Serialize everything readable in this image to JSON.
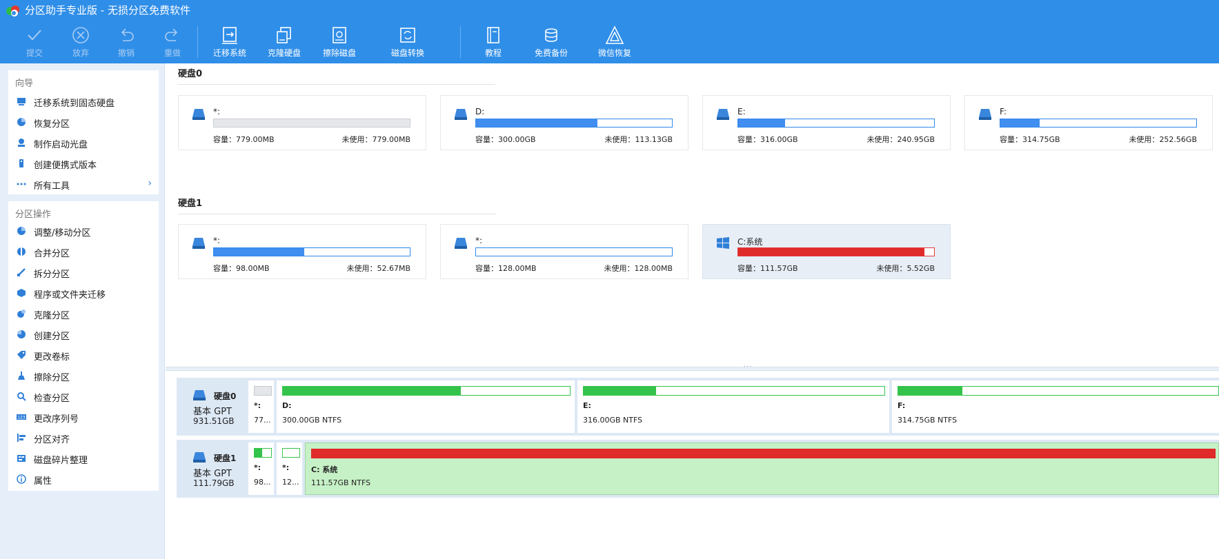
{
  "window": {
    "title": "分区助手专业版 - 无损分区免费软件"
  },
  "toolbar": {
    "items": [
      {
        "label": "提交",
        "icon": "check-icon",
        "enabled": false
      },
      {
        "label": "放弃",
        "icon": "close-circle-icon",
        "enabled": false
      },
      {
        "label": "撤销",
        "icon": "undo-icon",
        "enabled": false
      },
      {
        "label": "重做",
        "icon": "redo-icon",
        "enabled": false
      },
      {
        "label": "迁移系统",
        "icon": "migrate-os-icon",
        "enabled": true
      },
      {
        "label": "克隆硬盘",
        "icon": "clone-disk-icon",
        "enabled": true
      },
      {
        "label": "擦除磁盘",
        "icon": "wipe-disk-icon",
        "enabled": true
      },
      {
        "label": "磁盘转换",
        "icon": "disk-convert-icon",
        "enabled": true
      },
      {
        "label": "教程",
        "icon": "book-icon",
        "enabled": true
      },
      {
        "label": "免费备份",
        "icon": "backup-icon",
        "enabled": true
      },
      {
        "label": "微信恢复",
        "icon": "recovery-icon",
        "enabled": true
      }
    ]
  },
  "sidebar": {
    "wizard": {
      "title": "向导",
      "items": [
        {
          "label": "迁移系统到固态硬盘",
          "icon": "migrate-ssd-icon"
        },
        {
          "label": "恢复分区",
          "icon": "restore-partition-icon"
        },
        {
          "label": "制作启动光盘",
          "icon": "boot-disc-icon"
        },
        {
          "label": "创建便携式版本",
          "icon": "portable-icon"
        },
        {
          "label": "所有工具",
          "icon": "more-dots-icon"
        }
      ]
    },
    "operations": {
      "title": "分区操作",
      "items": [
        {
          "label": "调整/移动分区",
          "icon": "resize-icon"
        },
        {
          "label": "合并分区",
          "icon": "merge-icon"
        },
        {
          "label": "拆分分区",
          "icon": "split-icon"
        },
        {
          "label": "程序或文件夹迁移",
          "icon": "app-move-icon"
        },
        {
          "label": "克隆分区",
          "icon": "clone-partition-icon"
        },
        {
          "label": "创建分区",
          "icon": "create-partition-icon"
        },
        {
          "label": "更改卷标",
          "icon": "label-tag-icon"
        },
        {
          "label": "擦除分区",
          "icon": "wipe-partition-icon"
        },
        {
          "label": "检查分区",
          "icon": "check-partition-icon"
        },
        {
          "label": "更改序列号",
          "icon": "serial-number-icon"
        },
        {
          "label": "分区对齐",
          "icon": "align-icon"
        },
        {
          "label": "磁盘碎片整理",
          "icon": "defrag-icon"
        },
        {
          "label": "属性",
          "icon": "info-icon"
        }
      ]
    }
  },
  "labels": {
    "capacity": "容量：",
    "unused": "未使用："
  },
  "disks": [
    {
      "title": "硬盘0",
      "type": "基本 GPT",
      "size": "931.51GB",
      "partitions": [
        {
          "name": "*:",
          "capacity": "779.00MB",
          "unused": "779.00MB",
          "used_fraction": 0.0,
          "short": "77...",
          "style": "gray"
        },
        {
          "name": "D:",
          "capacity": "300.00GB",
          "unused": "113.13GB",
          "used_fraction": 0.62,
          "info": "300.00GB NTFS",
          "style": "blue"
        },
        {
          "name": "E:",
          "capacity": "316.00GB",
          "unused": "240.95GB",
          "used_fraction": 0.24,
          "info": "316.00GB NTFS",
          "style": "blue"
        },
        {
          "name": "F:",
          "capacity": "314.75GB",
          "unused": "252.56GB",
          "used_fraction": 0.2,
          "info": "314.75GB NTFS",
          "style": "blue"
        }
      ]
    },
    {
      "title": "硬盘1",
      "type": "基本 GPT",
      "size": "111.79GB",
      "partitions": [
        {
          "name": "*:",
          "capacity": "98.00MB",
          "unused": "52.67MB",
          "used_fraction": 0.46,
          "short": "98...",
          "style": "blue"
        },
        {
          "name": "*:",
          "capacity": "128.00MB",
          "unused": "128.00MB",
          "used_fraction": 0.0,
          "short": "12...",
          "style": "blue"
        },
        {
          "name": "C:系统",
          "capacity": "111.57GB",
          "unused": "5.52GB",
          "used_fraction": 0.95,
          "info": "111.57GB NTFS",
          "style": "red"
        }
      ]
    }
  ],
  "map_labels": {
    "d0p0": "*:",
    "d0p1": "D:",
    "d0p2": "E:",
    "d0p3": "F:",
    "d1p0": "*:",
    "d1p1": "*:",
    "d1p2": "C: 系统"
  },
  "colors": {
    "accent": "#2f8ee8",
    "used_bar": "#3f8ef0",
    "system_bar": "#e02b2b",
    "map_used": "#34c34a",
    "selected_block": "#c6f0c6"
  }
}
